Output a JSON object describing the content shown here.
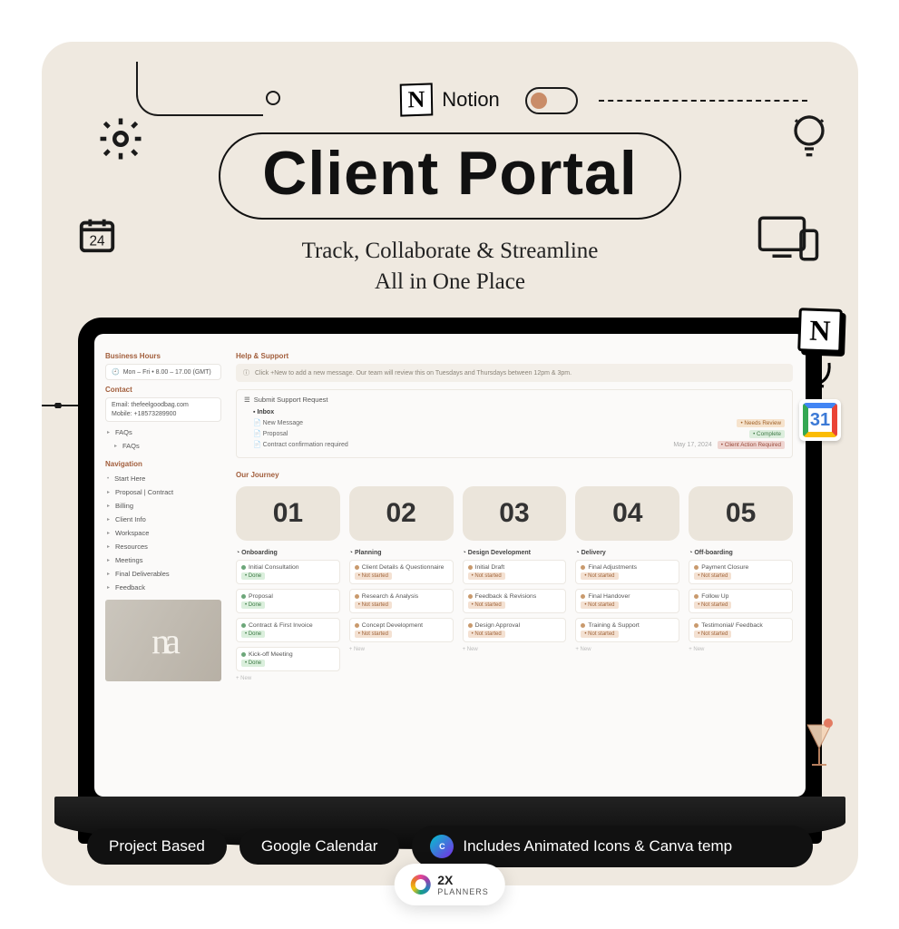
{
  "brand": {
    "name": "Notion",
    "letter": "N"
  },
  "hero": {
    "title": "Client Portal",
    "subtitle_line1": "Track, Collaborate & Streamline",
    "subtitle_line2": "All in One Place"
  },
  "calendar_deco_day": "24",
  "integrations": {
    "notion_letter": "N",
    "gcal_day": "31"
  },
  "footer": {
    "pill1": "Project Based",
    "pill2": "Google Calendar",
    "includes": "Includes Animated Icons & Canva temp"
  },
  "planners_badge": {
    "prefix": "2X",
    "name": "PLANNERS"
  },
  "screen": {
    "sidebar": {
      "business_hours": {
        "title": "Business Hours",
        "value": "Mon – Fri • 8.00 – 17.00 (GMT)"
      },
      "contact": {
        "title": "Contact",
        "email_label": "Email: thefeelgoodbag.com",
        "mobile_label": "Mobile: +18573289900",
        "faqs": "FAQs",
        "faqs_sub": "FAQs"
      },
      "navigation": {
        "title": "Navigation",
        "items": [
          "Start Here",
          "Proposal | Contract",
          "Billing",
          "Client Info",
          "Workspace",
          "Resources",
          "Meetings",
          "Final Deliverables",
          "Feedback"
        ]
      }
    },
    "main": {
      "help_title": "Help & Support",
      "notice": "Click +New to add a new message. Our team will review this on Tuesdays and Thursdays between 12pm & 3pm.",
      "support_panel_title": "Submit Support Request",
      "inbox_label": "Inbox",
      "messages": [
        {
          "title": "New Message",
          "badge": "Needs Review",
          "badge_class": "b-orange"
        },
        {
          "title": "Proposal",
          "badge": "Complete",
          "badge_class": "b-green"
        },
        {
          "title": "Contract confirmation required",
          "date": "May 17, 2024",
          "badge": "Client Action Required",
          "badge_class": "b-red"
        }
      ],
      "journey": {
        "title": "Our Journey",
        "steps": [
          "01",
          "02",
          "03",
          "04",
          "05"
        ],
        "columns": [
          {
            "title": "Onboarding",
            "tasks": [
              {
                "name": "Initial Consultation",
                "status": "Done"
              },
              {
                "name": "Proposal",
                "status": "Done"
              },
              {
                "name": "Contract & First Invoice",
                "status": "Done"
              },
              {
                "name": "Kick-off Meeting",
                "status": "Done"
              }
            ]
          },
          {
            "title": "Planning",
            "tasks": [
              {
                "name": "Client Details & Questionnaire",
                "status": "Not started"
              },
              {
                "name": "Research & Analysis",
                "status": "Not started"
              },
              {
                "name": "Concept Development",
                "status": "Not started"
              }
            ]
          },
          {
            "title": "Design Development",
            "tasks": [
              {
                "name": "Initial Draft",
                "status": "Not started"
              },
              {
                "name": "Feedback & Revisions",
                "status": "Not started"
              },
              {
                "name": "Design Approval",
                "status": "Not started"
              }
            ]
          },
          {
            "title": "Delivery",
            "tasks": [
              {
                "name": "Final Adjustments",
                "status": "Not started"
              },
              {
                "name": "Final Handover",
                "status": "Not started"
              },
              {
                "name": "Training & Support",
                "status": "Not started"
              }
            ]
          },
          {
            "title": "Off-boarding",
            "tasks": [
              {
                "name": "Payment Closure",
                "status": "Not started"
              },
              {
                "name": "Follow Up",
                "status": "Not started"
              },
              {
                "name": "Testimonial/ Feedback",
                "status": "Not started"
              }
            ]
          }
        ],
        "new_label": "+ New"
      }
    }
  }
}
